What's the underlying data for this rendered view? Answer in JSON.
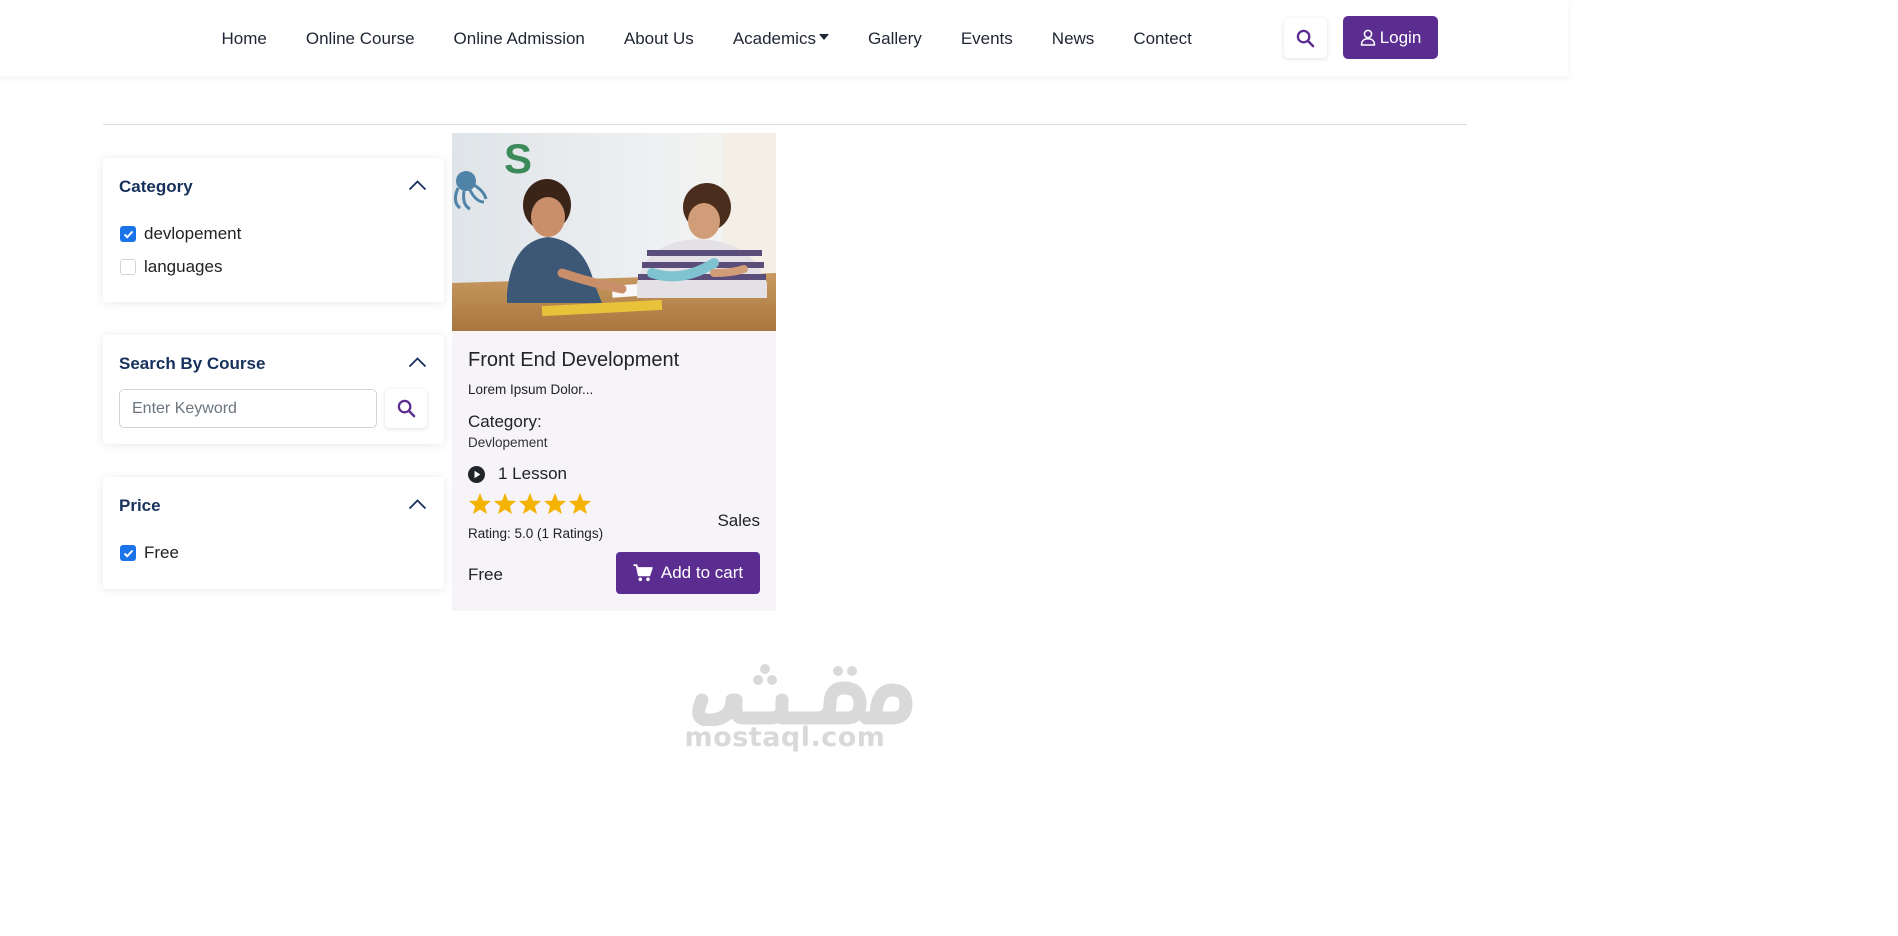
{
  "nav": {
    "items": [
      {
        "label": "Home"
      },
      {
        "label": "Online Course"
      },
      {
        "label": "Online Admission"
      },
      {
        "label": "About Us"
      },
      {
        "label": "Academics"
      },
      {
        "label": "Gallery"
      },
      {
        "label": "Events"
      },
      {
        "label": "News"
      },
      {
        "label": "Contect"
      }
    ],
    "login_label": "Login"
  },
  "filters": {
    "category": {
      "title": "Category",
      "options": [
        {
          "label": "devlopement",
          "checked": true
        },
        {
          "label": "languages",
          "checked": false
        }
      ]
    },
    "search": {
      "title": "Search By Course",
      "placeholder": "Enter Keyword",
      "value": ""
    },
    "price": {
      "title": "Price",
      "options": [
        {
          "label": "Free",
          "checked": true
        }
      ]
    }
  },
  "course": {
    "title": "Front End Development",
    "description": "Lorem Ipsum Dolor...",
    "category_label": "Category:",
    "category_value": "Devlopement",
    "lessons": "1 Lesson",
    "stars": 5,
    "rating_text": "Rating: 5.0 (1 Ratings)",
    "sales_label": "Sales",
    "price": "Free",
    "cart_label": "Add to cart"
  },
  "watermark": {
    "domain": "mostaql.com"
  },
  "colors": {
    "brand": "#5b2d91",
    "heading": "#17315c",
    "checkbox": "#1a73e8",
    "star": "#f5b301",
    "card_bg": "#f6f4f9"
  }
}
